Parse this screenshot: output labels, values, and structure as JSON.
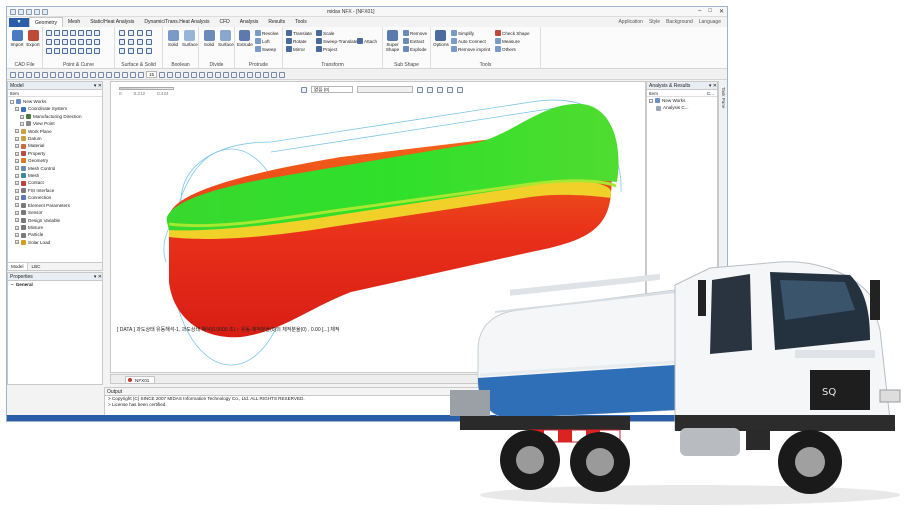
{
  "app": {
    "window_title": "midas NFX - [NFX01]",
    "window_controls": [
      "–",
      "□",
      "✕"
    ]
  },
  "menu": {
    "app_button": "▼",
    "tabs": [
      "Geometry",
      "Mesh",
      "Static/Heat Analysis",
      "Dynamic/Trans.Heat Analysis",
      "CFD",
      "Analysis",
      "Results",
      "Tools"
    ],
    "active_tab": "Geometry",
    "right": [
      "Application",
      "Style",
      "Background",
      "Language"
    ]
  },
  "ribbon": {
    "cad_file": {
      "label": "CAD File",
      "import": "Import",
      "export": "Export"
    },
    "point_curve": {
      "label": "Point & Curve"
    },
    "surface_solid": {
      "label": "Surface & Solid"
    },
    "boolean": {
      "label": "Boolean",
      "solid": "Solid",
      "surface": "Surface"
    },
    "divide": {
      "label": "Divide",
      "solid": "Solid",
      "surface": "Surface"
    },
    "protrude": {
      "label": "Protrude",
      "extrude": "Extrude",
      "revolve": "Revolve",
      "loft": "Loft",
      "sweep": "Sweep"
    },
    "transform": {
      "label": "Transform",
      "translate": "Translate",
      "rotate": "Rotate",
      "mirror": "Mirror",
      "scale": "Scale",
      "sweep_translate": "Sweep-Translate",
      "project": "Project",
      "attach": "Attach"
    },
    "sub_shape": {
      "label": "Sub Shape",
      "super_shape": "Super Shape",
      "remove": "Remove",
      "extract": "Extract",
      "explode": "Explode"
    },
    "tools": {
      "label": "Tools",
      "options": "Options",
      "simplify": "Simplify",
      "auto_connect": "Auto Connect",
      "remove_imprint": "Remove imprint",
      "check_shape": "Check Shape",
      "measure": "Measure",
      "others": "Others"
    }
  },
  "toolbar2": {
    "zoom_value": "15",
    "combo1": "없음 (0)",
    "combo2": ""
  },
  "model_panel": {
    "title": "Model",
    "column": "Item",
    "tree": [
      {
        "label": "New Works",
        "icon": "folder-icon",
        "color": "#6b8fc9",
        "level": 0
      },
      {
        "label": "Coordinate System",
        "icon": "coordinate-icon",
        "color": "#3a6fbf",
        "level": 1
      },
      {
        "label": "Manufacturing Direction",
        "icon": "direction-icon",
        "color": "#4a7a3a",
        "level": 2
      },
      {
        "label": "View Point",
        "icon": "viewpoint-icon",
        "color": "#8a8a8a",
        "level": 2
      },
      {
        "label": "Work Plane",
        "icon": "plane-icon",
        "color": "#c9a040",
        "level": 1
      },
      {
        "label": "Datum",
        "icon": "datum-icon",
        "color": "#c9a040",
        "level": 1
      },
      {
        "label": "Material",
        "icon": "material-icon",
        "color": "#c96a3a",
        "level": 1
      },
      {
        "label": "Property",
        "icon": "property-icon",
        "color": "#b74a4a",
        "level": 1
      },
      {
        "label": "Geometry",
        "icon": "geometry-icon",
        "color": "#e07a20",
        "level": 1
      },
      {
        "label": "Mesh Control",
        "icon": "mesh-control-icon",
        "color": "#6a8ab0",
        "level": 1
      },
      {
        "label": "Mesh",
        "icon": "mesh-icon",
        "color": "#3a8a9a",
        "level": 1
      },
      {
        "label": "Contact",
        "icon": "contact-icon",
        "color": "#c04040",
        "level": 1
      },
      {
        "label": "FSI Interface",
        "icon": "fsi-icon",
        "color": "#7a7a7a",
        "level": 1
      },
      {
        "label": "Connection",
        "icon": "connection-icon",
        "color": "#5a7ab0",
        "level": 1
      },
      {
        "label": "Element Parameters",
        "icon": "element-params-icon",
        "color": "#7a7a7a",
        "level": 1
      },
      {
        "label": "Sensor",
        "icon": "sensor-icon",
        "color": "#7a7a7a",
        "level": 1
      },
      {
        "label": "Design Variable",
        "icon": "design-variable-icon",
        "color": "#7a7a7a",
        "level": 1
      },
      {
        "label": "Mixture",
        "icon": "mixture-icon",
        "color": "#7a7a7a",
        "level": 1
      },
      {
        "label": "Particle",
        "icon": "particle-icon",
        "color": "#7a7a7a",
        "level": 1
      },
      {
        "label": "Solar Load",
        "icon": "solar-icon",
        "color": "#d0a020",
        "level": 1
      }
    ],
    "tabs": [
      "Model",
      "LBC"
    ]
  },
  "properties_panel": {
    "title": "Properties",
    "section": "General"
  },
  "analysis_panel": {
    "title": "Analysis & Results",
    "columns": [
      "Item",
      "C..."
    ],
    "tree": [
      {
        "label": "New Works",
        "level": 0
      },
      {
        "label": "Analysis C...",
        "level": 1
      }
    ]
  },
  "task_pane": {
    "label": "Task Pane"
  },
  "viewport": {
    "scale_labels": [
      "0",
      "0.212",
      "0.424"
    ],
    "caption": "[ DATA ] 과도상태 유동해석-1, 과도상태 해석(0.0000 초) :: 유동-체적분율(0)의 체적분율(0) , 0.00 [...] 체적"
  },
  "doc_tab": {
    "label": "NFX01"
  },
  "output": {
    "title": "Output",
    "lines": [
      "> Copyright (C) SINCE 2007 MIDAS Information Technology Co., Ltd. ALL RIGHTS RESERVED.",
      "> License has been certified."
    ]
  },
  "colors": {
    "accent": "#2a5ea8",
    "fluid_green": "#2fd82a",
    "tank_red": "#e8301a",
    "outline": "#6ec0e8"
  }
}
